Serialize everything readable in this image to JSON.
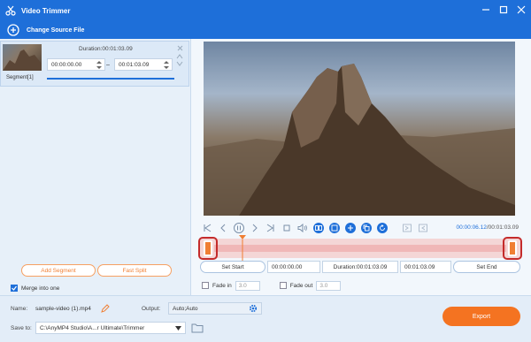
{
  "window": {
    "title": "Video Trimmer"
  },
  "source": {
    "change_label": "Change Source File"
  },
  "segment": {
    "label": "Segment[1]",
    "duration": "Duration:00:01:03.09",
    "start": "00:00:00.00",
    "end": "00:01:03.09"
  },
  "left_actions": {
    "add_segment": "Add Segment",
    "fast_split": "Fast Split",
    "merge_label": "Merge into one",
    "merge_checked": true
  },
  "player": {
    "current_time": "00:00:06.12",
    "total_time": "/00:01:03.09",
    "progress": 0.097
  },
  "set_row": {
    "set_start": "Set Start",
    "start_value": "00:00:00.00",
    "duration": "Duration:00:01:03.09",
    "end_value": "00:01:03.09",
    "set_end": "Set End"
  },
  "fade": {
    "in_label": "Fade in",
    "in_value": "3.0",
    "out_label": "Fade out",
    "out_value": "3.0"
  },
  "bottom": {
    "name_label": "Name:",
    "name_value": "sample-video (1).mp4",
    "output_label": "Output:",
    "output_value": "Auto;Auto",
    "save_label": "Save to:",
    "save_path": "C:\\AnyMP4 Studio\\A...r Ultimate\\Trimmer",
    "export_label": "Export"
  },
  "colors": {
    "brand": "#1e6fd9",
    "accent": "#f47321",
    "handle_highlight": "#c42b2b"
  }
}
